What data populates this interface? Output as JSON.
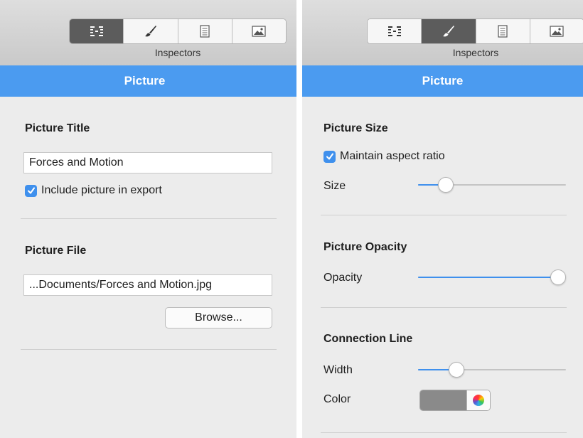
{
  "accent_color": "#4b9bf0",
  "left": {
    "toolbar": {
      "icons": [
        "outline-icon",
        "brush-icon",
        "document-icon",
        "picture-icon"
      ],
      "active": "outline-icon",
      "label": "Inspectors"
    },
    "panel_title": "Picture",
    "picture_title": {
      "heading": "Picture Title",
      "value": "Forces and Motion",
      "include_label": "Include picture in export",
      "include_checked": true
    },
    "picture_file": {
      "heading": "Picture File",
      "value": "...Documents/Forces and Motion.jpg",
      "browse_label": "Browse..."
    }
  },
  "right": {
    "toolbar": {
      "icons": [
        "outline-icon",
        "brush-icon",
        "document-icon",
        "picture-icon"
      ],
      "active": "brush-icon",
      "label": "Inspectors"
    },
    "panel_title": "Picture",
    "picture_size": {
      "heading": "Picture Size",
      "aspect_label": "Maintain aspect ratio",
      "aspect_checked": true,
      "size_label": "Size",
      "size_value": 0.15
    },
    "picture_opacity": {
      "heading": "Picture Opacity",
      "opacity_label": "Opacity",
      "opacity_value": 1.0
    },
    "connection_line": {
      "heading": "Connection Line",
      "width_label": "Width",
      "width_value": 0.23,
      "color_label": "Color",
      "color_value": "#8a8a8a"
    }
  }
}
